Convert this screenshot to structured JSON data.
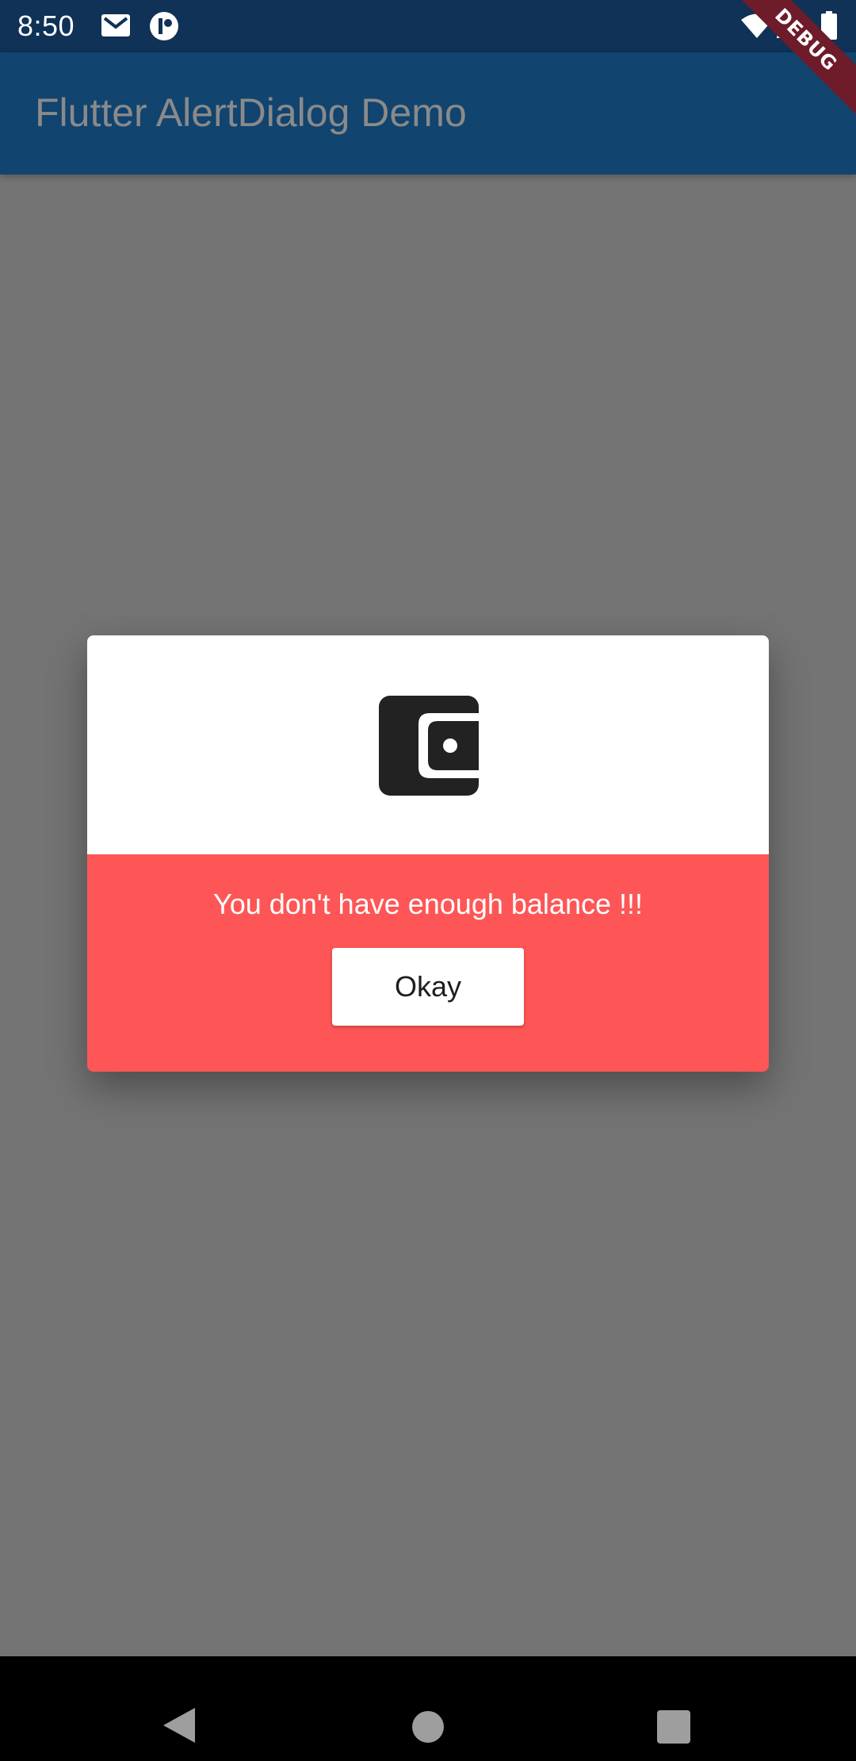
{
  "status_bar": {
    "time": "8:50",
    "left_icons": [
      "gmail-icon",
      "app-notification-icon"
    ],
    "right_icons": [
      "wifi-icon",
      "signal-icon",
      "battery-icon"
    ]
  },
  "app_bar": {
    "title": "Flutter AlertDialog Demo"
  },
  "debug_banner": {
    "label": "DEBUG"
  },
  "dialog": {
    "icon": "wallet-icon",
    "message": "You don't have enough balance !!!",
    "button_label": "Okay"
  },
  "nav_bar": {
    "buttons": [
      "back-icon",
      "home-icon",
      "recents-icon"
    ]
  },
  "colors": {
    "status_bar": "#0f3256",
    "app_bar": "#11446f",
    "scrim": "#747474",
    "dialog_accent": "#fe5656",
    "debug_banner": "#6e1b2a"
  }
}
